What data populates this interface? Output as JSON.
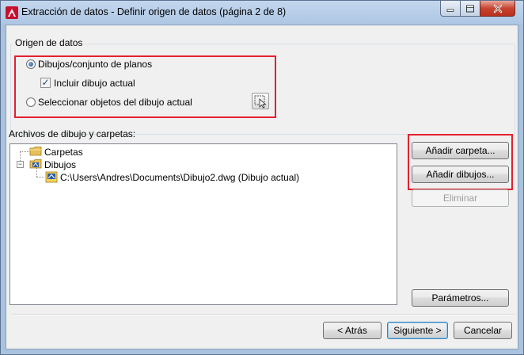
{
  "window": {
    "title": "Extracción de datos - Definir origen de datos (página 2 de 8)",
    "app_icon": "autocad-a-icon"
  },
  "origin_group": {
    "legend": "Origen de datos",
    "option_drawings": {
      "label": "Dibujos/conjunto de planos",
      "checked": true
    },
    "option_include_current": {
      "label": "Incluir dibujo actual",
      "checked": true
    },
    "option_select_objects": {
      "label": "Seleccionar objetos del dibujo actual",
      "checked": false
    },
    "pick_icon": "select-objects-icon"
  },
  "files_section": {
    "label": "Archivos de dibujo y carpetas:",
    "tree": [
      {
        "label": "Carpetas",
        "icon": "folder-icon",
        "level": 0
      },
      {
        "label": "Dibujos",
        "icon": "drawings-folder-icon",
        "level": 0,
        "expanded": true
      },
      {
        "label": "C:\\Users\\Andres\\Documents\\Dibujo2.dwg (Dibujo actual)",
        "icon": "dwg-file-icon",
        "level": 1
      }
    ]
  },
  "side_buttons": {
    "add_folder": "Añadir carpeta...",
    "add_drawings": "Añadir dibujos...",
    "remove": "Eliminar",
    "settings": "Parámetros..."
  },
  "footer": {
    "back": "< Atrás",
    "next": "Siguiente >",
    "cancel": "Cancelar"
  },
  "colors": {
    "highlight": "#e5202e",
    "title_gradient_top": "#c3d7ee",
    "client_bg": "#f0f0f0"
  }
}
